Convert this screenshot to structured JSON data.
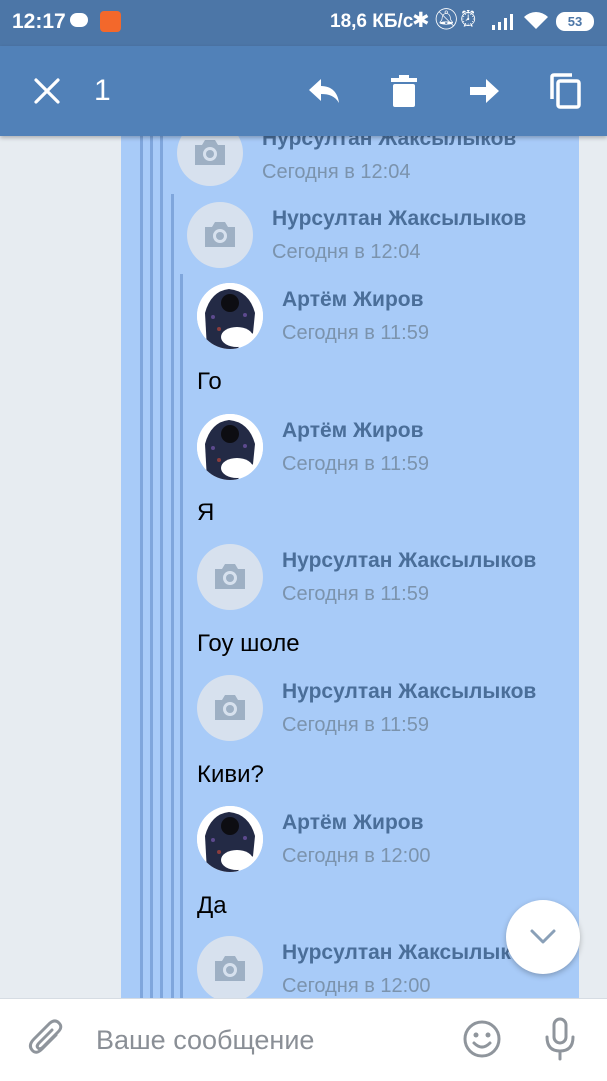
{
  "status_bar": {
    "time": "12:17",
    "speed": "18,6 КБ/с",
    "battery": "53"
  },
  "action_bar": {
    "selected_count": "1",
    "icons": [
      "close-icon",
      "reply-icon",
      "trash-icon",
      "forward-icon",
      "copy-icon"
    ]
  },
  "messages": [
    {
      "author": "Нурсултан Жаксылыков",
      "time": "Сегодня в 12:04",
      "text": ""
    },
    {
      "author": "Нурсултан Жаксылыков",
      "time": "Сегодня в 12:04",
      "text": ""
    },
    {
      "author": "Артём Жиров",
      "time": "Сегодня в 11:59",
      "text": "Го"
    },
    {
      "author": "Артём Жиров",
      "time": "Сегодня в 11:59",
      "text": "Я"
    },
    {
      "author": "Нурсултан Жаксылыков",
      "time": "Сегодня в 11:59",
      "text": "Гоу шоле"
    },
    {
      "author": "Нурсултан Жаксылыков",
      "time": "Сегодня в 11:59",
      "text": "Киви?"
    },
    {
      "author": "Артём Жиров",
      "time": "Сегодня в 12:00",
      "text": "Да"
    },
    {
      "author": "Нурсултан Жаксылыков",
      "time": "Сегодня в 12:00",
      "text": ""
    }
  ],
  "input": {
    "placeholder": "Ваше сообщение"
  },
  "colors": {
    "header": "#5181b8",
    "status_bar": "#4c76a7",
    "selection": "#a8cbf8",
    "author_name": "#4a6e99"
  }
}
